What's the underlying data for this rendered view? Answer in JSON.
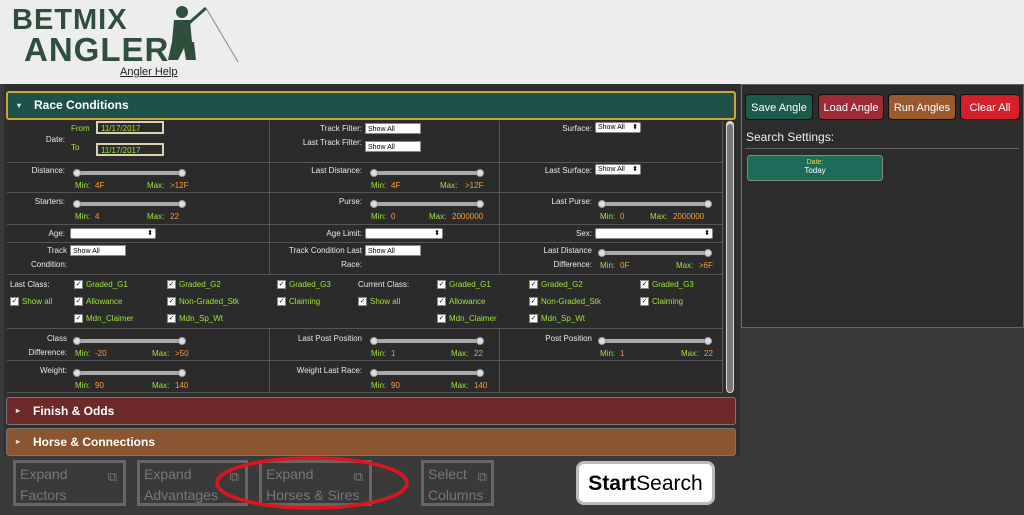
{
  "logo": {
    "line1": "BETMIX",
    "line2": "ANGLER",
    "help": "Angler Help"
  },
  "panels": {
    "race": "Race Conditions",
    "finish": "Finish & Odds",
    "horse": "Horse & Connections"
  },
  "rc": {
    "date_label": "Date:",
    "from": "From",
    "to": "To",
    "from_val": "11/17/2017",
    "to_val": "11/17/2017",
    "track_filter": "Track Filter:",
    "track_filter_val": "Show All",
    "last_track_filter": "Last Track Filter:",
    "last_track_filter_val": "Show All",
    "surface": "Surface:",
    "surface_val": "Show All",
    "distance": "Distance:",
    "last_distance": "Last Distance:",
    "last_surface": "Last Surface:",
    "last_surface_val": "Show All",
    "min": "Min:",
    "max": "Max:",
    "dist_min": "4F",
    "dist_max": ">12F",
    "ldist_min": "4F",
    "ldist_max": ">12F",
    "starters": "Starters:",
    "starters_min": "4",
    "starters_max": "22",
    "purse": "Purse:",
    "purse_min": "0",
    "purse_max": "2000000",
    "last_purse": "Last Purse:",
    "lpurse_min": "0",
    "lpurse_max": "2000000",
    "age": "Age:",
    "age_limit": "Age Limit:",
    "sex": "Sex:",
    "track_cond1": "Track",
    "track_cond2": "Condition:",
    "track_cond_val": "Show All",
    "track_cond_last1": "Track Condition Last",
    "track_cond_last2": "Race:",
    "track_cond_last_val": "Show All",
    "last_dist_diff1": "Last Distance",
    "last_dist_diff2": "Difference:",
    "ldd_min": "0F",
    "ldd_max": ">6F",
    "last_class": "Last Class:",
    "current_class": "Current Class:",
    "class_items_last": [
      "Graded_G1",
      "Graded_G2",
      "Graded_G3",
      "Show all",
      "Allowance",
      "Non-Graded_Stk",
      "Claiming",
      "Mdn_Claimer",
      "Mdn_Sp_Wt"
    ],
    "class_items_cur": [
      "Graded_G1",
      "Graded_G2",
      "Graded_G3",
      "Show all",
      "Allowance",
      "Non-Graded_Stk",
      "Claiming",
      "Mdn_Claimer",
      "Mdn_Sp_Wt"
    ],
    "class_diff1": "Class",
    "class_diff2": "Difference:",
    "cd_min": "-20",
    "cd_max": ">50",
    "last_post": "Last Post Position",
    "lp_min": "1",
    "lp_max": "22",
    "post": "Post Position",
    "p_min": "1",
    "p_max": "22",
    "weight": "Weight:",
    "w_min": "90",
    "w_max": "140",
    "weight_last": "Weight Last Race:",
    "wl_min": "90",
    "wl_max": "140"
  },
  "buttons": {
    "save": "Save Angle",
    "load": "Load Angle",
    "run": "Run Angles",
    "clear": "Clear All"
  },
  "colors": {
    "save": "#1e5a4c",
    "load": "#9c2b36",
    "run": "#9a5a2e",
    "clear": "#d3202a"
  },
  "search": {
    "title": "Search Settings:",
    "chip_label": "Date:",
    "chip_value": "Today"
  },
  "bottom": {
    "factors1": "Expand",
    "factors2": "Factors",
    "adv1": "Expand",
    "adv2": "Advantages",
    "hs1": "Expand",
    "hs2": "Horses & Sires",
    "cols1": "Select",
    "cols2": "Columns",
    "start_bold": "Start",
    "start_rest": "Search"
  }
}
